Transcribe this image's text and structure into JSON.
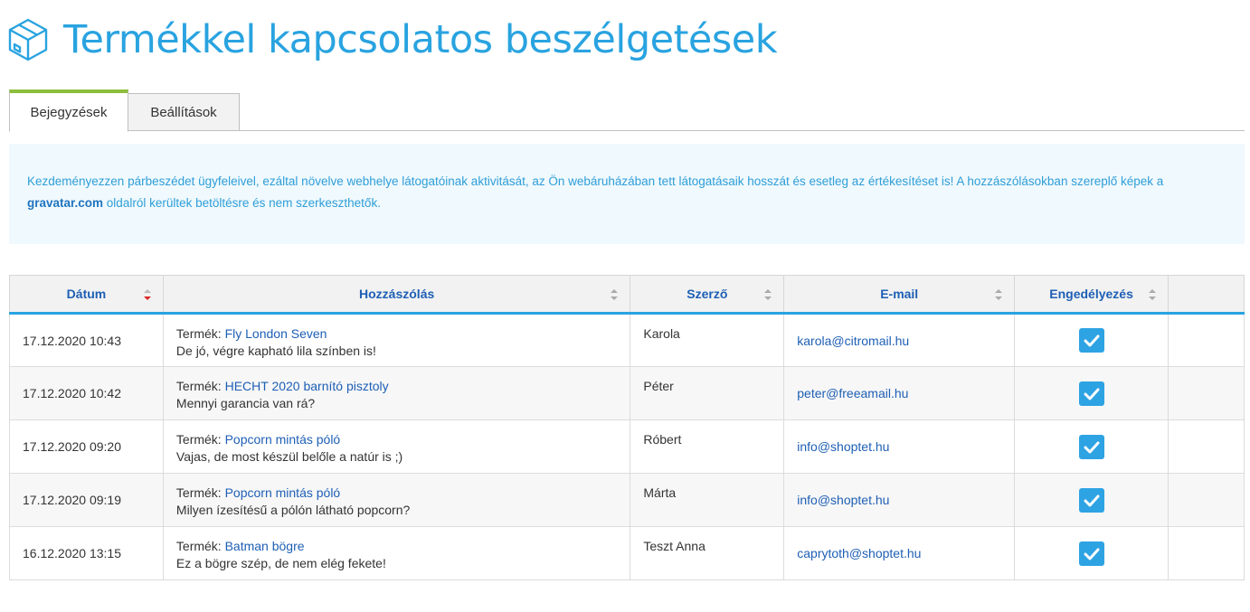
{
  "page": {
    "title": "Termékkel kapcsolatos beszélgetések"
  },
  "tabs": [
    {
      "label": "Bejegyzések",
      "active": true
    },
    {
      "label": "Beállítások",
      "active": false
    }
  ],
  "info": {
    "text_before": "Kezdeményezzen párbeszédet ügyfeleivel, ezáltal növelve webhelye látogatóinak aktivitását, az Ön webáruházában tett látogatásaik hosszát és esetleg az értékesítéset is! A hozzászólásokban szereplő képek a ",
    "link": "gravatar.com",
    "text_after": " oldalról kerültek betöltésre és nem szerkeszthetők."
  },
  "table": {
    "columns": [
      "Dátum",
      "Hozzászólás",
      "Szerző",
      "E-mail",
      "Engedélyezés"
    ],
    "product_prefix": "Termék:",
    "rows": [
      {
        "date": "17.12.2020 10:43",
        "product": "Fly London Seven",
        "comment": "De jó, végre kapható lila színben is!",
        "author": "Karola",
        "email": "karola@citromail.hu",
        "approved": true
      },
      {
        "date": "17.12.2020 10:42",
        "product": "HECHT 2020 barnító pisztoly",
        "comment": "Mennyi garancia van rá?",
        "author": "Péter",
        "email": "peter@freeamail.hu",
        "approved": true
      },
      {
        "date": "17.12.2020 09:20",
        "product": "Popcorn mintás póló",
        "comment": "Vajas, de most készül belőle a natúr is ;)",
        "author": "Róbert",
        "email": "info@shoptet.hu",
        "approved": true
      },
      {
        "date": "17.12.2020 09:19",
        "product": "Popcorn mintás póló",
        "comment": "Milyen ízesítésű a pólón látható popcorn?",
        "author": "Márta",
        "email": "info@shoptet.hu",
        "approved": true
      },
      {
        "date": "16.12.2020 13:15",
        "product": "Batman bögre",
        "comment": "Ez a bögre szép, de nem elég fekete!",
        "author": "Teszt Anna",
        "email": "caprytoth@shoptet.hu",
        "approved": true
      }
    ]
  },
  "icons": {
    "header": "box-icon",
    "sort": "sort-icon",
    "check": "checkbox-checked-icon"
  },
  "colors": {
    "accent": "#29a3e0",
    "tab_active": "#8dbe3c",
    "link": "#1e5fb5",
    "checkbox": "#2ea3e3"
  }
}
